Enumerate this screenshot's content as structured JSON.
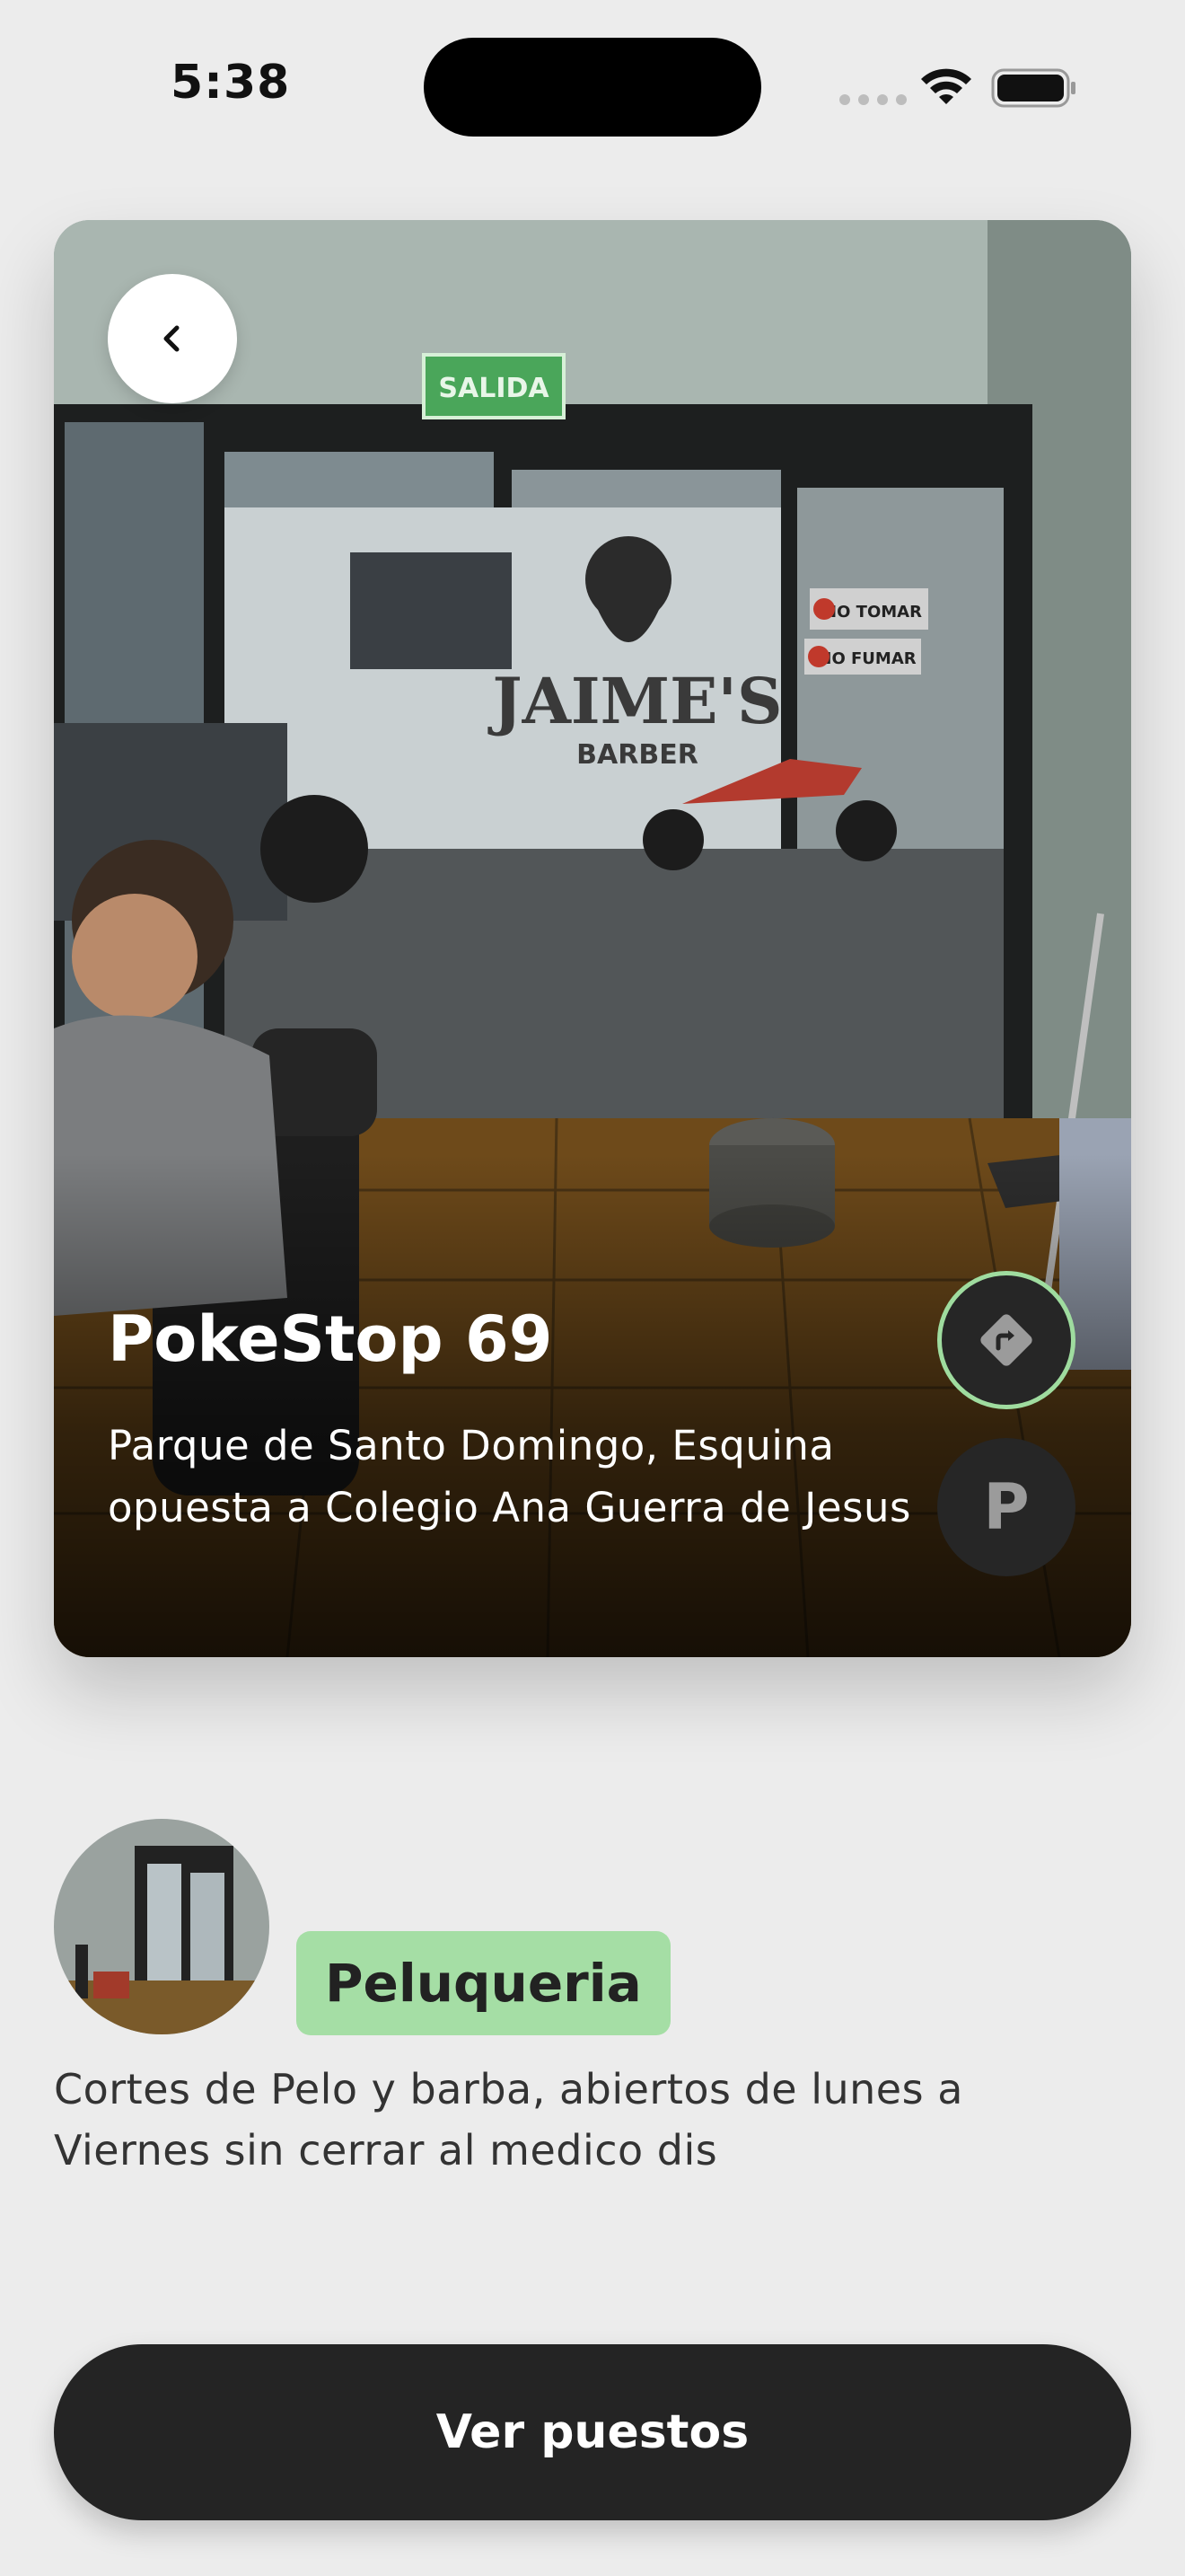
{
  "status_bar": {
    "time": "5:38"
  },
  "hero": {
    "title": "PokeStop 69",
    "address": "Parque de Santo Domingo, Esquina opuesta a Colegio Ana Guerra de Jesus",
    "photo_sign_exit": "SALIDA",
    "photo_window_text": "JAIME'S",
    "photo_window_subtext": "BARBER",
    "photo_sign_no_drink": "NO TOMAR",
    "photo_sign_no_smoke": "NO FUMAR",
    "parking_label": "P",
    "icons": {
      "back": "chevron-left-icon",
      "directions": "directions-icon"
    },
    "colors": {
      "directions_border": "#9fdc9f",
      "button_bg": "#262626"
    }
  },
  "details": {
    "category": "Peluqueria",
    "description": "Cortes de Pelo y barba, abiertos de lunes a Viernes sin cerrar al medico dis",
    "colors": {
      "category_bg": "#a5dea5"
    }
  },
  "actions": {
    "primary_label": "Ver puestos"
  }
}
